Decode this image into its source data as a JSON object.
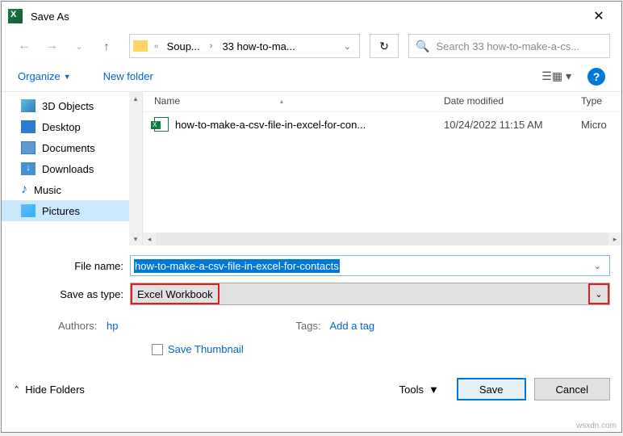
{
  "title": "Save As",
  "breadcrumb": {
    "prefix": "«",
    "item1": "Soup...",
    "item2": "33 how-to-ma..."
  },
  "search": {
    "placeholder": "Search 33 how-to-make-a-cs..."
  },
  "toolbar": {
    "organize": "Organize",
    "new_folder": "New folder"
  },
  "sidebar": {
    "items": [
      "3D Objects",
      "Desktop",
      "Documents",
      "Downloads",
      "Music",
      "Pictures"
    ]
  },
  "columns": {
    "name": "Name",
    "date": "Date modified",
    "type": "Type"
  },
  "files": [
    {
      "name": "how-to-make-a-csv-file-in-excel-for-con...",
      "date": "10/24/2022 11:15 AM",
      "type": "Micro"
    }
  ],
  "form": {
    "filename_label": "File name:",
    "filename_value": "how-to-make-a-csv-file-in-excel-for-contacts",
    "filetype_label": "Save as type:",
    "filetype_value": "Excel Workbook"
  },
  "meta": {
    "authors_label": "Authors:",
    "authors_value": "hp",
    "tags_label": "Tags:",
    "tags_value": "Add a tag"
  },
  "thumbnail_label": "Save Thumbnail",
  "footer": {
    "hide_folders": "Hide Folders",
    "tools": "Tools",
    "save": "Save",
    "cancel": "Cancel"
  },
  "watermark": "wsxdn.com"
}
